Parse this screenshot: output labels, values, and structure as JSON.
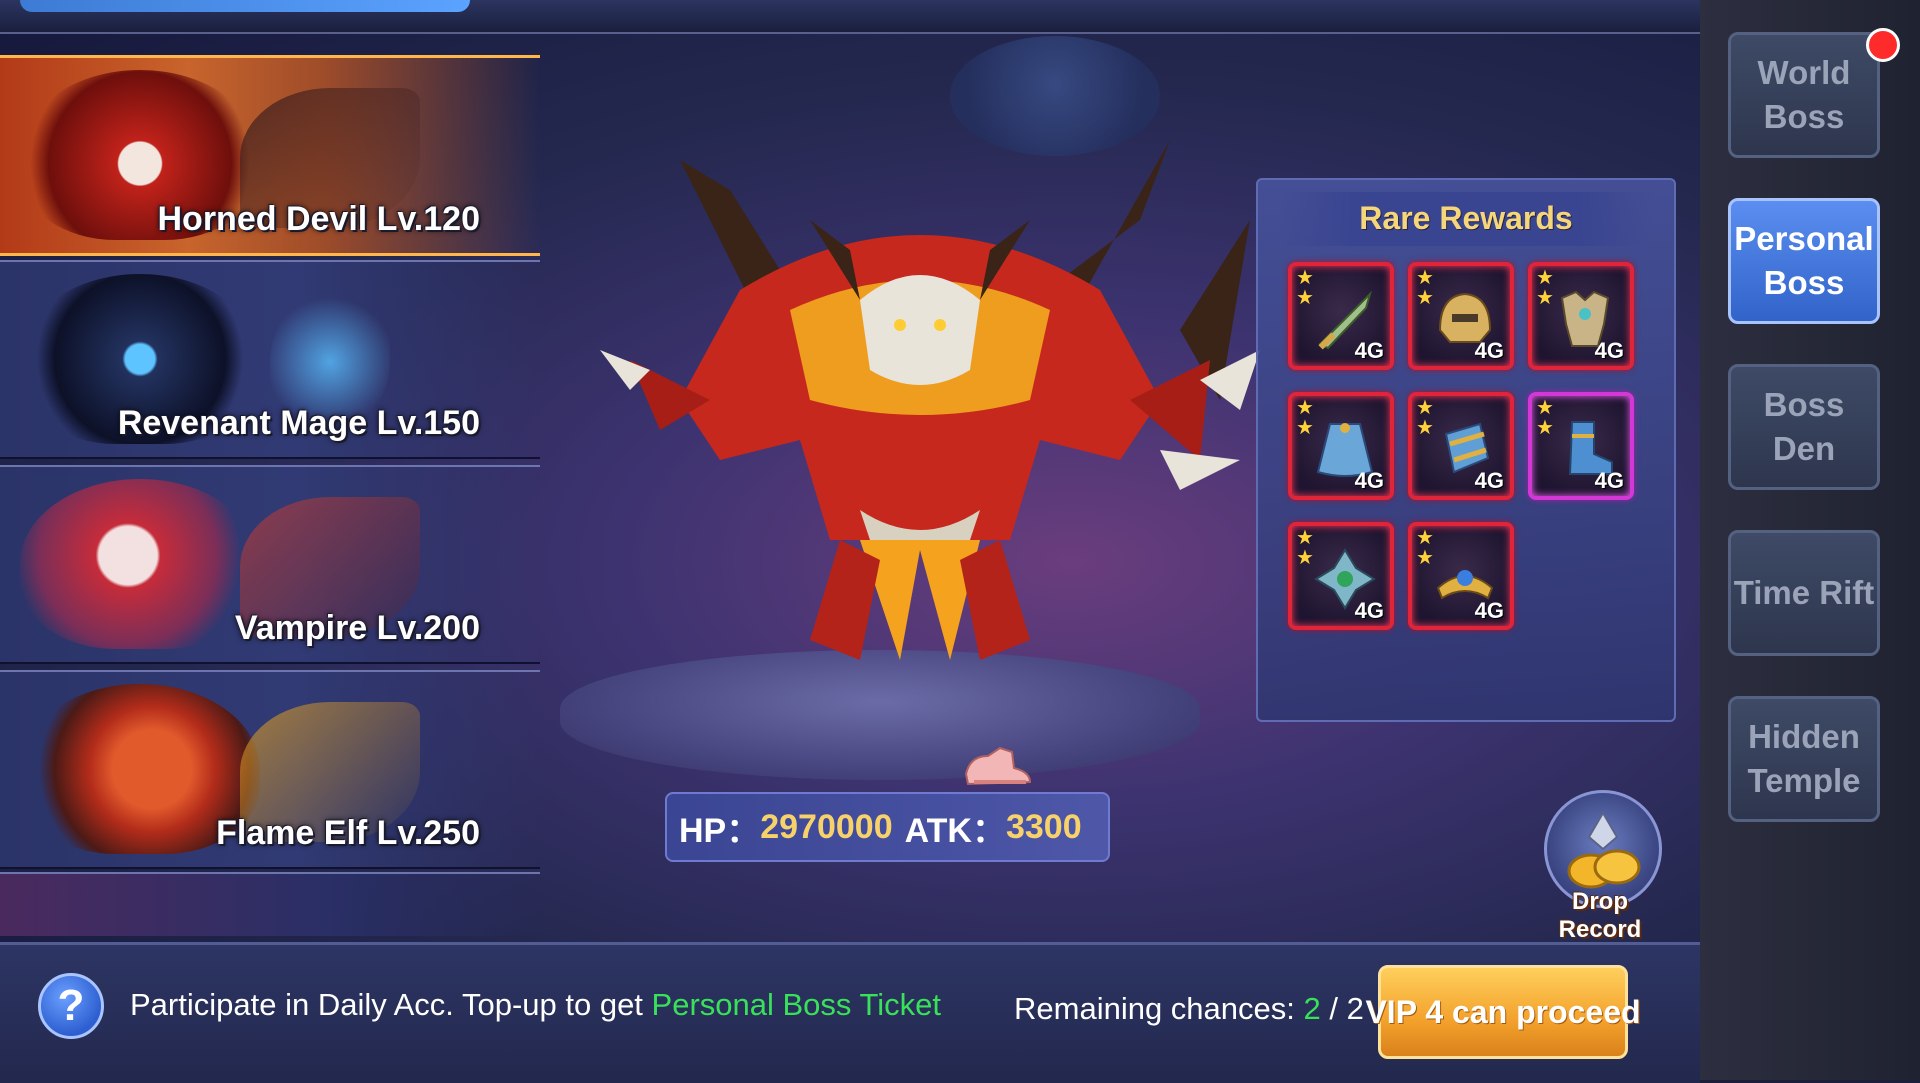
{
  "boss_list": [
    {
      "name": "Horned Devil Lv.120",
      "selected": true
    },
    {
      "name": "Revenant Mage Lv.150",
      "selected": false
    },
    {
      "name": "Vampire Lv.200",
      "selected": false
    },
    {
      "name": "Flame Elf Lv.250",
      "selected": false
    }
  ],
  "boss_stats": {
    "hp_label": "HP：",
    "hp_value": "2970000",
    "atk_label": "ATK：",
    "atk_value": "3300"
  },
  "rewards": {
    "title": "Rare Rewards",
    "items": [
      {
        "icon": "sword-icon",
        "grade": "4G",
        "frame": "red"
      },
      {
        "icon": "helmet-icon",
        "grade": "4G",
        "frame": "red"
      },
      {
        "icon": "armor-icon",
        "grade": "4G",
        "frame": "red"
      },
      {
        "icon": "cloak-icon",
        "grade": "4G",
        "frame": "red"
      },
      {
        "icon": "bracer-icon",
        "grade": "4G",
        "frame": "red"
      },
      {
        "icon": "boots-icon",
        "grade": "4G",
        "frame": "purple"
      },
      {
        "icon": "amulet-icon",
        "grade": "4G",
        "frame": "red"
      },
      {
        "icon": "crown-icon",
        "grade": "4G",
        "frame": "red"
      }
    ]
  },
  "drop_record": {
    "label": "Drop Record"
  },
  "bottom": {
    "tip_prefix": "Participate in Daily Acc. Top-up to get ",
    "tip_highlight": "Personal Boss Ticket",
    "chances_label": "Remaining chances: ",
    "chances_current": "2",
    "chances_sep": " / ",
    "chances_total": "2",
    "proceed_label": "VIP 4 can proceed",
    "help_symbol": "?"
  },
  "side_tabs": [
    {
      "label": "World Boss",
      "active": false
    },
    {
      "label": "Personal Boss",
      "active": true
    },
    {
      "label": "Boss Den",
      "active": false
    },
    {
      "label": "Time Rift",
      "active": false
    },
    {
      "label": "Hidden Temple",
      "active": false
    }
  ],
  "colors": {
    "accent_gold": "#f5d77a",
    "highlight_green": "#39e05a",
    "reward_frame_red": "#e0243a",
    "reward_frame_purple": "#d338d6",
    "active_tab_blue": "#3163c9"
  }
}
